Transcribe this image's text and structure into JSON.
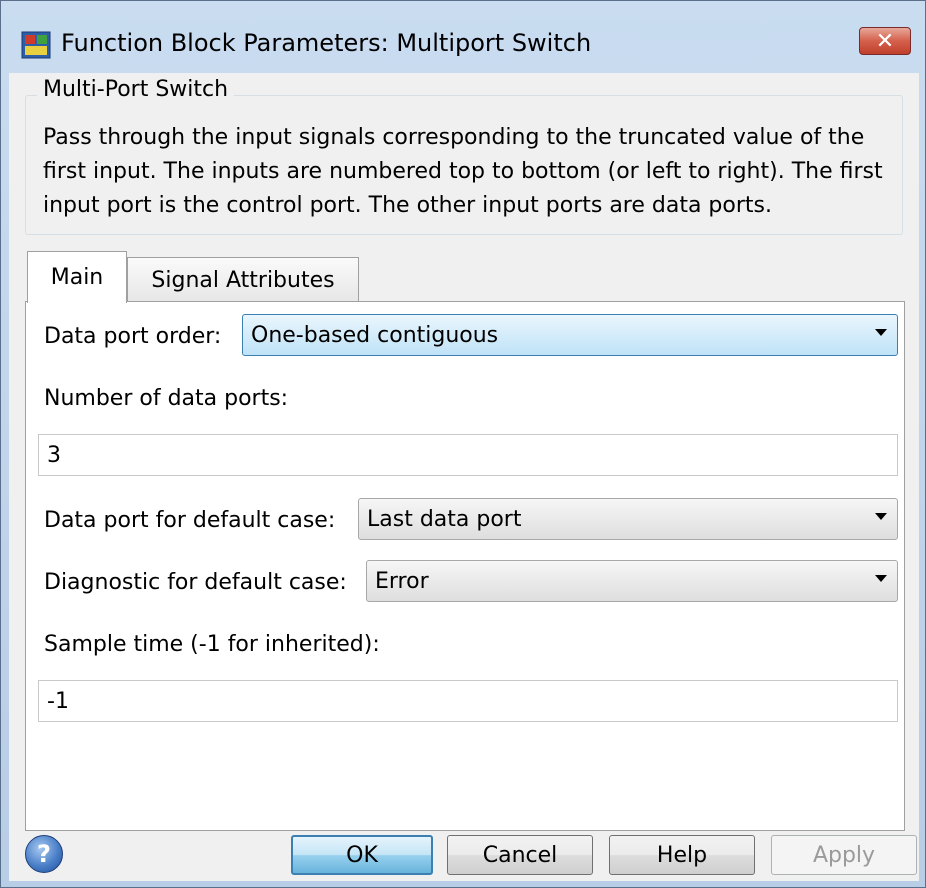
{
  "window": {
    "title": "Function Block Parameters: Multiport Switch",
    "close_label": "✕"
  },
  "group": {
    "title": "Multi-Port Switch",
    "description": "Pass through the input signals corresponding to the truncated value of the first input. The inputs are numbered top to bottom (or left to right). The first input port is the control port. The other input ports are data ports."
  },
  "tabs": [
    {
      "label": "Main",
      "active": true
    },
    {
      "label": "Signal Attributes",
      "active": false
    }
  ],
  "main": {
    "data_port_order": {
      "label": "Data port order:",
      "value": "One-based contiguous"
    },
    "number_of_ports": {
      "label": "Number of data ports:",
      "value": "3"
    },
    "default_case_port": {
      "label": "Data port for default case:",
      "value": "Last data port"
    },
    "diagnostic": {
      "label": "Diagnostic for default case:",
      "value": "Error"
    },
    "sample_time": {
      "label": "Sample time (-1 for inherited):",
      "value": "-1"
    }
  },
  "buttons": {
    "help_icon": "?",
    "ok": "OK",
    "cancel": "Cancel",
    "help": "Help",
    "apply": "Apply"
  },
  "colors": {
    "focus_accent": "#3c7fb1",
    "close_red": "#c0402c"
  }
}
